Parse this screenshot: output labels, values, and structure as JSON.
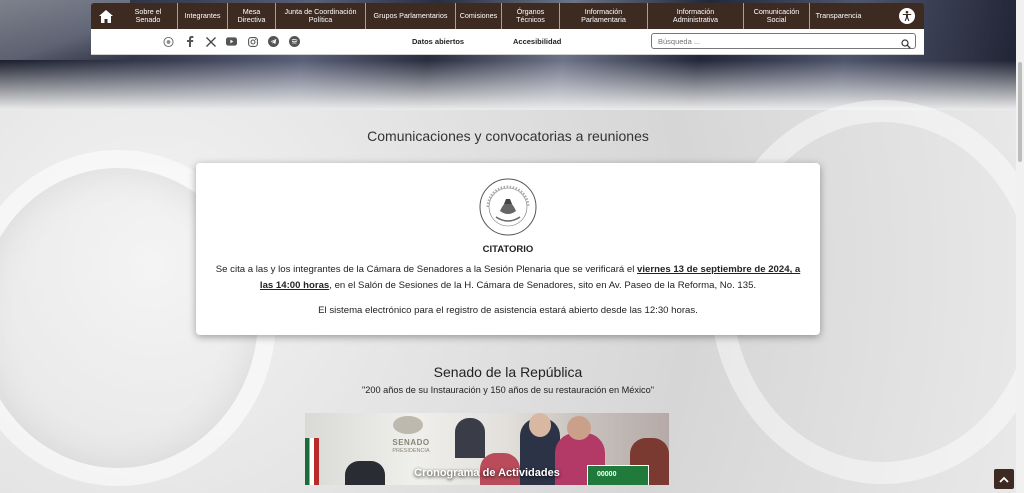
{
  "nav": {
    "items": [
      {
        "label": "Sobre el Senado",
        "name": "nav-item-sobre-el-senado",
        "width": 58
      },
      {
        "label": "Integrantes",
        "name": "nav-item-integrantes",
        "width": 50
      },
      {
        "label": "Mesa Directiva",
        "name": "nav-item-mesa-directiva",
        "width": 48
      },
      {
        "label": "Junta de Coordinación Política",
        "name": "nav-item-junta-de-coordinacion-politica",
        "width": 90
      },
      {
        "label": "Grupos Parlamentarios",
        "name": "nav-item-grupos-parlamentarios",
        "width": 90
      },
      {
        "label": "Comisiones",
        "name": "nav-item-comisiones",
        "width": 46
      },
      {
        "label": "Órganos Técnicos",
        "name": "nav-item-organos-tecnicos",
        "width": 58
      },
      {
        "label": "Información Parlamentaria",
        "name": "nav-item-informacion-parlamentaria",
        "width": 88
      },
      {
        "label": "Información Administrativa",
        "name": "nav-item-informacion-administrativa",
        "width": 96
      },
      {
        "label": "Comunicación Social",
        "name": "nav-item-comunicacion-social",
        "width": 66
      },
      {
        "label": "Transparencia",
        "name": "nav-item-transparencia",
        "width": 58
      }
    ]
  },
  "subbar": {
    "datos_abiertos": "Datos abiertos",
    "accesibilidad": "Accesibilidad",
    "search_placeholder": "Búsqueda ..."
  },
  "main": {
    "section_title": "Comunicaciones y convocatorias a reuniones",
    "citatorio": {
      "heading": "CITATORIO",
      "text_pre": "Se cita a las y los integrantes de la Cámara de Senadores a la Sesión Plenaria que se verificará el ",
      "text_bold": "viernes 13 de septiembre de 2024, a las 14:00 horas",
      "text_post": ", en el Salón de Sesiones de la H. Cámara de Senadores, sito en Av. Paseo de la Reforma, No. 135.",
      "note": "El sistema electrónico para el registro de asistencia estará abierto desde las 12:30 horas."
    },
    "senado_title": "Senado de la República",
    "senado_subtitle": "\"200 años de su Instauración y 150 años de su restauración en México\"",
    "banner": {
      "label": "Cronograma de Actividades",
      "wall_text": "SENADO",
      "wall_text2": "PRESIDENCIA",
      "sign_text": "00000"
    }
  },
  "colors": {
    "nav_bg": "#3d2b22",
    "card_bg": "#ffffff"
  }
}
